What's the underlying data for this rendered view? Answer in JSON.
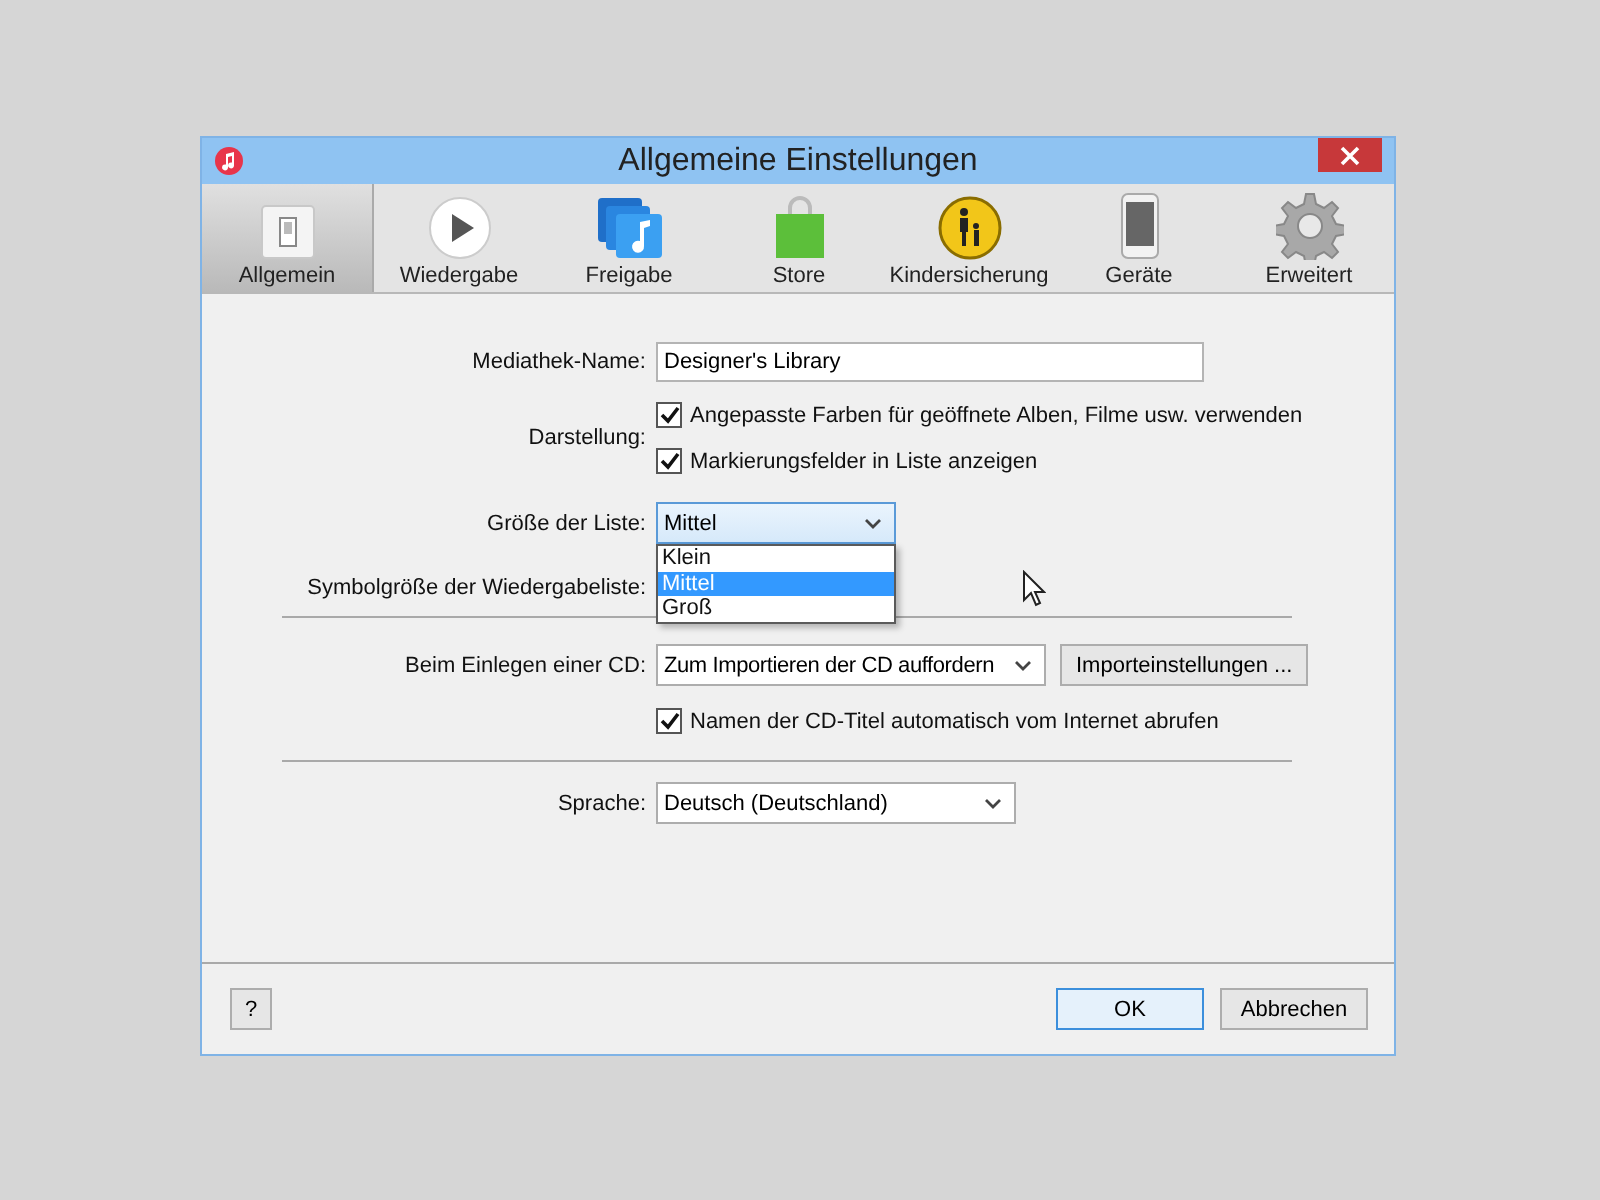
{
  "window": {
    "title": "Allgemeine Einstellungen"
  },
  "toolbar": {
    "tabs": [
      {
        "label": "Allgemein",
        "selected": true
      },
      {
        "label": "Wiedergabe",
        "selected": false
      },
      {
        "label": "Freigabe",
        "selected": false
      },
      {
        "label": "Store",
        "selected": false
      },
      {
        "label": "Kindersicherung",
        "selected": false
      },
      {
        "label": "Geräte",
        "selected": false
      },
      {
        "label": "Erweitert",
        "selected": false
      }
    ]
  },
  "library_name": {
    "label": "Mediathek-Name:",
    "value": "Designer's Library"
  },
  "display": {
    "label": "Darstellung:",
    "options": [
      {
        "label": "Angepasste Farben für geöffnete Alben, Filme usw. verwenden",
        "checked": true
      },
      {
        "label": "Markierungsfelder in Liste anzeigen",
        "checked": true
      }
    ]
  },
  "list_size": {
    "label": "Größe der Liste:",
    "value": "Mittel",
    "expanded": true,
    "options": [
      {
        "label": "Klein",
        "selected": false
      },
      {
        "label": "Mittel",
        "selected": true
      },
      {
        "label": "Groß",
        "selected": false
      }
    ]
  },
  "playlist_icon_size": {
    "label": "Symbolgröße der Wiedergabeliste:"
  },
  "cd_insert": {
    "label": "Beim Einlegen einer CD:",
    "value": "Zum Importieren der CD auffordern",
    "button": "Importeinstellungen ..."
  },
  "cd_names": {
    "label": "Namen der CD-Titel automatisch vom Internet abrufen",
    "checked": true
  },
  "language": {
    "label": "Sprache:",
    "value": "Deutsch (Deutschland)"
  },
  "help_button": "?",
  "buttons": [
    {
      "label": "OK",
      "default": true
    },
    {
      "label": "Abbrechen",
      "default": false
    }
  ]
}
